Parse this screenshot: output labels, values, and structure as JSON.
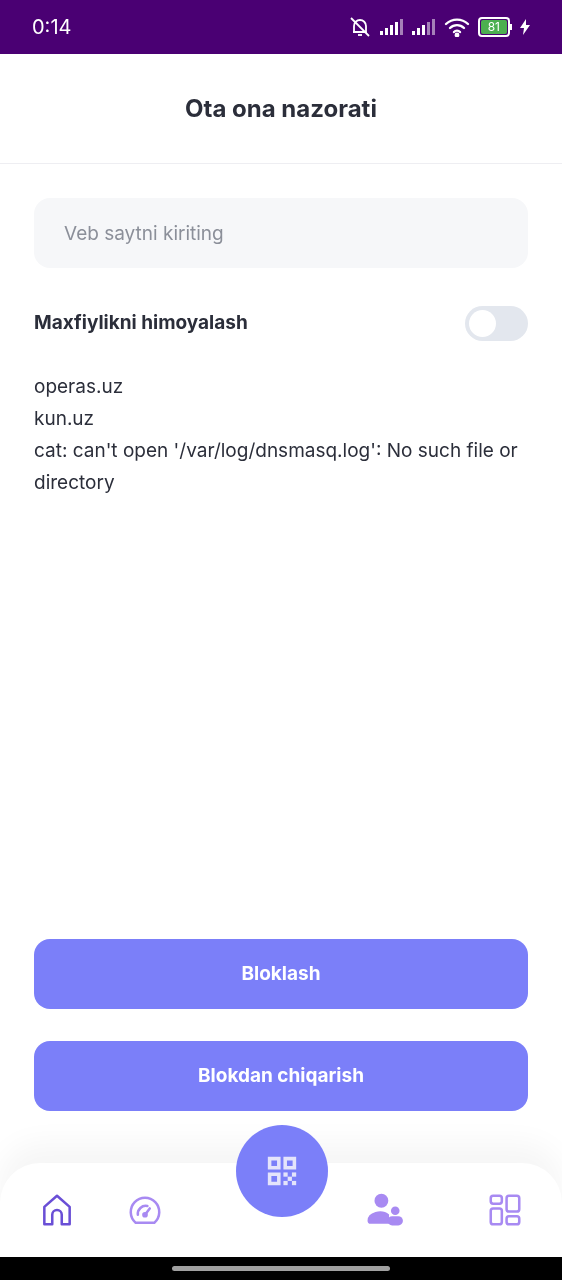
{
  "status_bar": {
    "time": "0:14",
    "battery": "81"
  },
  "header": {
    "title": "Ota ona nazorati"
  },
  "website_field": {
    "placeholder": "Veb saytni kiriting"
  },
  "privacy_toggle": {
    "label": "Maxfiylikni himoyalash",
    "on": false
  },
  "log_lines": [
    "operas.uz",
    "kun.uz",
    "cat: can't open '/var/log/dnsmasq.log': No such file or directory"
  ],
  "buttons": [
    "Bloklash",
    "Blokdan chiqarish"
  ],
  "bottom_nav": [
    {
      "selected": true
    },
    {
      "selected": false
    },
    {
      "selected": false
    },
    {
      "selected": false
    }
  ]
}
